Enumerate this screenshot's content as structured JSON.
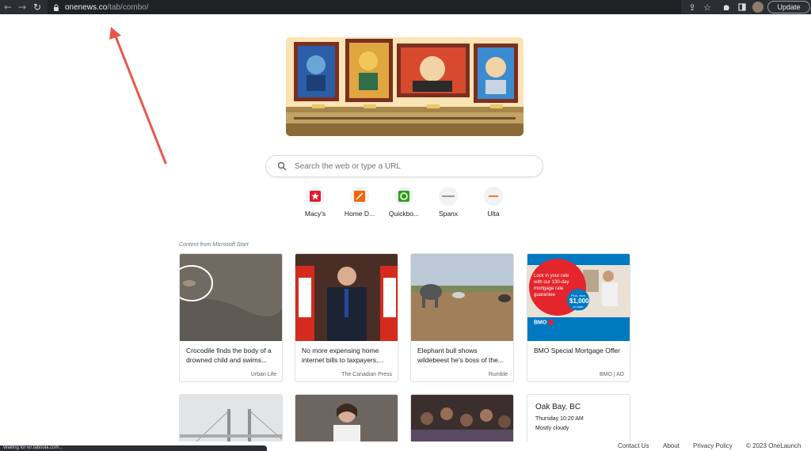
{
  "browser": {
    "url_host": "onenews.co",
    "url_path": "/tab/combo/",
    "update_label": "Update",
    "icons": [
      "back-icon",
      "forward-icon",
      "reload-icon",
      "lock-icon",
      "share-icon",
      "star-icon",
      "extensions-icon",
      "sidepanel-icon"
    ]
  },
  "search": {
    "placeholder": "Search the web or type a URL"
  },
  "shortcuts": [
    {
      "label": "Macy's",
      "color": "#e21a2c"
    },
    {
      "label": "Home D...",
      "color": "#f96302"
    },
    {
      "label": "Quickbo...",
      "color": "#2ca01c"
    },
    {
      "label": "Spanx",
      "color": "#999999"
    },
    {
      "label": "Ulta",
      "color": "#f47d30"
    }
  ],
  "feed": {
    "label": "Content from Microsoft Start",
    "cards": [
      {
        "title": "Crocodile finds the body of a drowned child and swims...",
        "source": "Urban Life"
      },
      {
        "title": "No more expensing home internet bills to taxpayers,...",
        "source": "The Canadian Press"
      },
      {
        "title": "Elephant bull shows wildebeest he's boss of the...",
        "source": "Rumble"
      },
      {
        "title": "BMO Special Mortgage Offer",
        "source": "BMO | AD"
      }
    ],
    "ad": {
      "line1": "Lock in your rate",
      "line2": "with our 130-day",
      "line3": "mortgage rate",
      "line4": "guarantee",
      "badge_small": "Plus, earn",
      "badge_big": "$1,000",
      "badge_tail": "in cash back",
      "brand": "BMO"
    },
    "weather": {
      "city": "Oak Bay, BC",
      "time": "Thursday 10:20 AM",
      "condition": "Mostly cloudy"
    }
  },
  "status": {
    "text": "Waiting for w/.taboola.com..."
  },
  "footer": {
    "contact": "Contact Us",
    "about": "About",
    "privacy": "Privacy Policy",
    "copyright": "© 2023 OneLaunch"
  }
}
